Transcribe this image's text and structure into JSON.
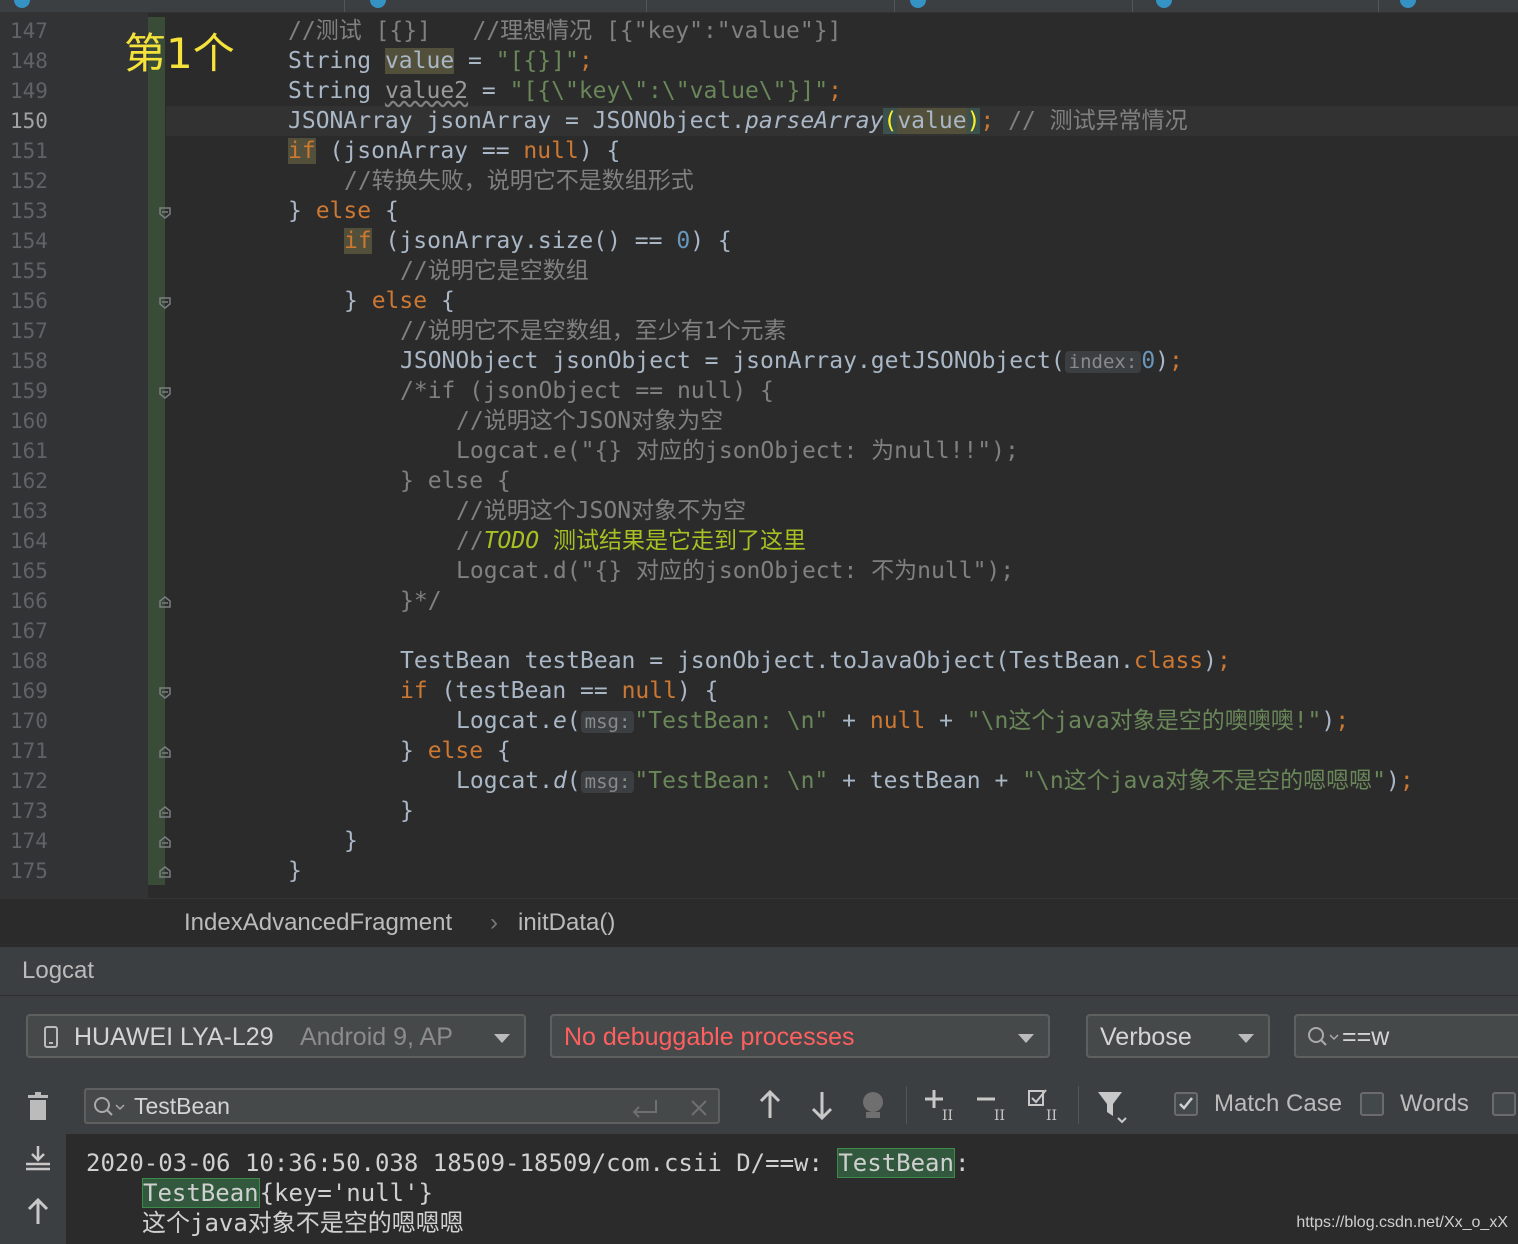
{
  "annotation_label": "第1个",
  "editor": {
    "line_numbers": [
      "147",
      "148",
      "149",
      "150",
      "151",
      "152",
      "153",
      "154",
      "155",
      "156",
      "157",
      "158",
      "159",
      "160",
      "161",
      "162",
      "163",
      "164",
      "165",
      "166",
      "167",
      "168",
      "169",
      "170",
      "171",
      "172",
      "173",
      "174",
      "175"
    ],
    "current_line": "150",
    "code": {
      "l147a": "//测试 [{}]   //理想情况 [{\"key\":\"value\"}]",
      "l148a": "String ",
      "l148b": "value",
      "l148c": " = ",
      "l148d": "\"[{}]\"",
      "l148e": ";",
      "l149a": "String ",
      "l149b": "value2",
      "l149c": " = ",
      "l149d": "\"[{\\\"key\\\":\\\"value\\\"}]\"",
      "l149e": ";",
      "l150a": "JSONArray jsonArray = JSONObject.",
      "l150b": "parseArray",
      "l150c": "(",
      "l150d": "value",
      "l150e": ")",
      "l150f": ";",
      "l150g": " // 测试异常情况",
      "l151a": "if",
      "l151b": " (jsonArray == ",
      "l151c": "null",
      "l151d": ") {",
      "l152a": "//转换失败，说明它不是数组形式",
      "l153a": "} ",
      "l153b": "else",
      "l153c": " {",
      "l154a": "if",
      "l154b": " (jsonArray.size() == ",
      "l154c": "0",
      "l154d": ") {",
      "l155a": "//说明它是空数组",
      "l156a": "} ",
      "l156b": "else",
      "l156c": " {",
      "l157a": "//说明它不是空数组，至少有1个元素",
      "l158a": "JSONObject jsonObject = jsonArray.getJSONObject(",
      "l158b": "index:",
      "l158c": "0",
      "l158d": ")",
      "l158e": ";",
      "l159a": "/*if (jsonObject == null) {",
      "l160a": "//说明这个JSON对象为空",
      "l161a": "Logcat.e(\"{} 对应的jsonObject: 为null!!\");",
      "l162a": "} else {",
      "l163a": "//说明这个JSON对象不为空",
      "l164a": "//",
      "l164b": "TODO",
      "l164c": " 测试结果是它走到了这里",
      "l165a": "Logcat.d(\"{} 对应的jsonObject: 不为null\");",
      "l166a": "}*/",
      "l168a": "TestBean testBean = jsonObject.toJavaObject(TestBean.",
      "l168b": "class",
      "l168c": ")",
      "l168d": ";",
      "l169a": "if",
      "l169b": " (testBean == ",
      "l169c": "null",
      "l169d": ") {",
      "l170a": "Logcat.",
      "l170b": "e",
      "l170c": "(",
      "l170d": "msg:",
      "l170e": "\"TestBean: \\n\"",
      "l170f": " + ",
      "l170g": "null",
      "l170h": " + ",
      "l170i": "\"\\n这个java对象是空的噢噢噢!\"",
      "l170j": ")",
      "l170k": ";",
      "l171a": "} ",
      "l171b": "else",
      "l171c": " {",
      "l172a": "Logcat.",
      "l172b": "d",
      "l172c": "(",
      "l172d": "msg:",
      "l172e": "\"TestBean: \\n\"",
      "l172f": " + testBean + ",
      "l172g": "\"\\n这个java对象不是空的嗯嗯嗯\"",
      "l172h": ")",
      "l172i": ";",
      "l173a": "}",
      "l174a": "}",
      "l175a": "}"
    }
  },
  "breadcrumb": {
    "class_name": "IndexAdvancedFragment",
    "separator": "›",
    "method": "initData()"
  },
  "logcat": {
    "title": "Logcat",
    "device": {
      "name": "HUAWEI LYA-L29",
      "detail": "Android 9, AP"
    },
    "process": "No debuggable processes",
    "level": "Verbose",
    "tag_search": "==w",
    "filter_text": "TestBean",
    "match_case_label": "Match Case",
    "match_case_checked": true,
    "words_label": "Words",
    "words_checked": false,
    "lines": {
      "line1_prefix": "2020-03-06 10:36:50.038 18509-18509/com.csii D/==w: ",
      "line1_match": "TestBean",
      "line1_suffix": ":",
      "line2_match": "TestBean",
      "line2_suffix": "{key='null'}",
      "line3": "这个java对象不是空的嗯嗯嗯"
    }
  },
  "watermark": "https://blog.csdn.net/Xx_o_xX",
  "colors": {
    "keyword": "#cc7832",
    "string": "#6a8759",
    "number": "#6897bb",
    "comment": "#808080",
    "error_text": "#ff5f5f",
    "match_highlight": "#32593d"
  }
}
